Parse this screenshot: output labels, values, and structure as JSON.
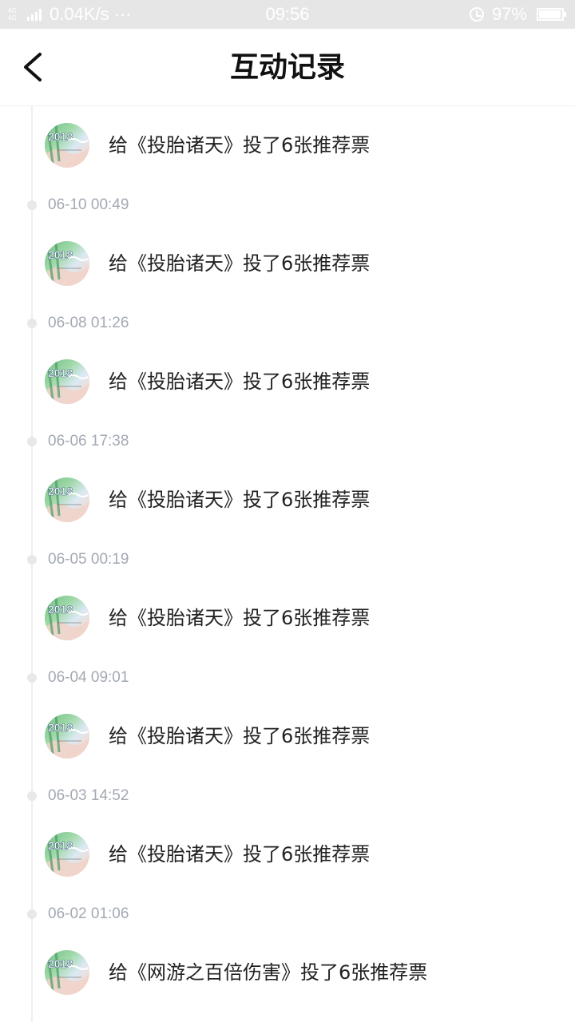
{
  "status_bar": {
    "network_label": "4G 4G",
    "speed": "0.04K/s",
    "more": "···",
    "time": "09:56",
    "battery": "97%",
    "battery_level": 0.97
  },
  "header": {
    "title": "互动记录",
    "back_icon": "chevron-left-icon"
  },
  "records": [
    {
      "text": "给《投胎诸天》投了6张推荐票",
      "time": "06-10 00:49"
    },
    {
      "text": "给《投胎诸天》投了6张推荐票",
      "time": "06-08 01:26"
    },
    {
      "text": "给《投胎诸天》投了6张推荐票",
      "time": "06-06 17:38"
    },
    {
      "text": "给《投胎诸天》投了6张推荐票",
      "time": "06-05 00:19"
    },
    {
      "text": "给《投胎诸天》投了6张推荐票",
      "time": "06-04 09:01"
    },
    {
      "text": "给《投胎诸天》投了6张推荐票",
      "time": "06-03 14:52"
    },
    {
      "text": "给《投胎诸天》投了6张推荐票",
      "time": "06-02 01:06"
    },
    {
      "text": "给《网游之百倍伤害》投了6张推荐票",
      "time": ""
    }
  ],
  "colors": {
    "timestamp": "#a3a9b3",
    "timeline": "#efefef",
    "text": "#222222"
  }
}
